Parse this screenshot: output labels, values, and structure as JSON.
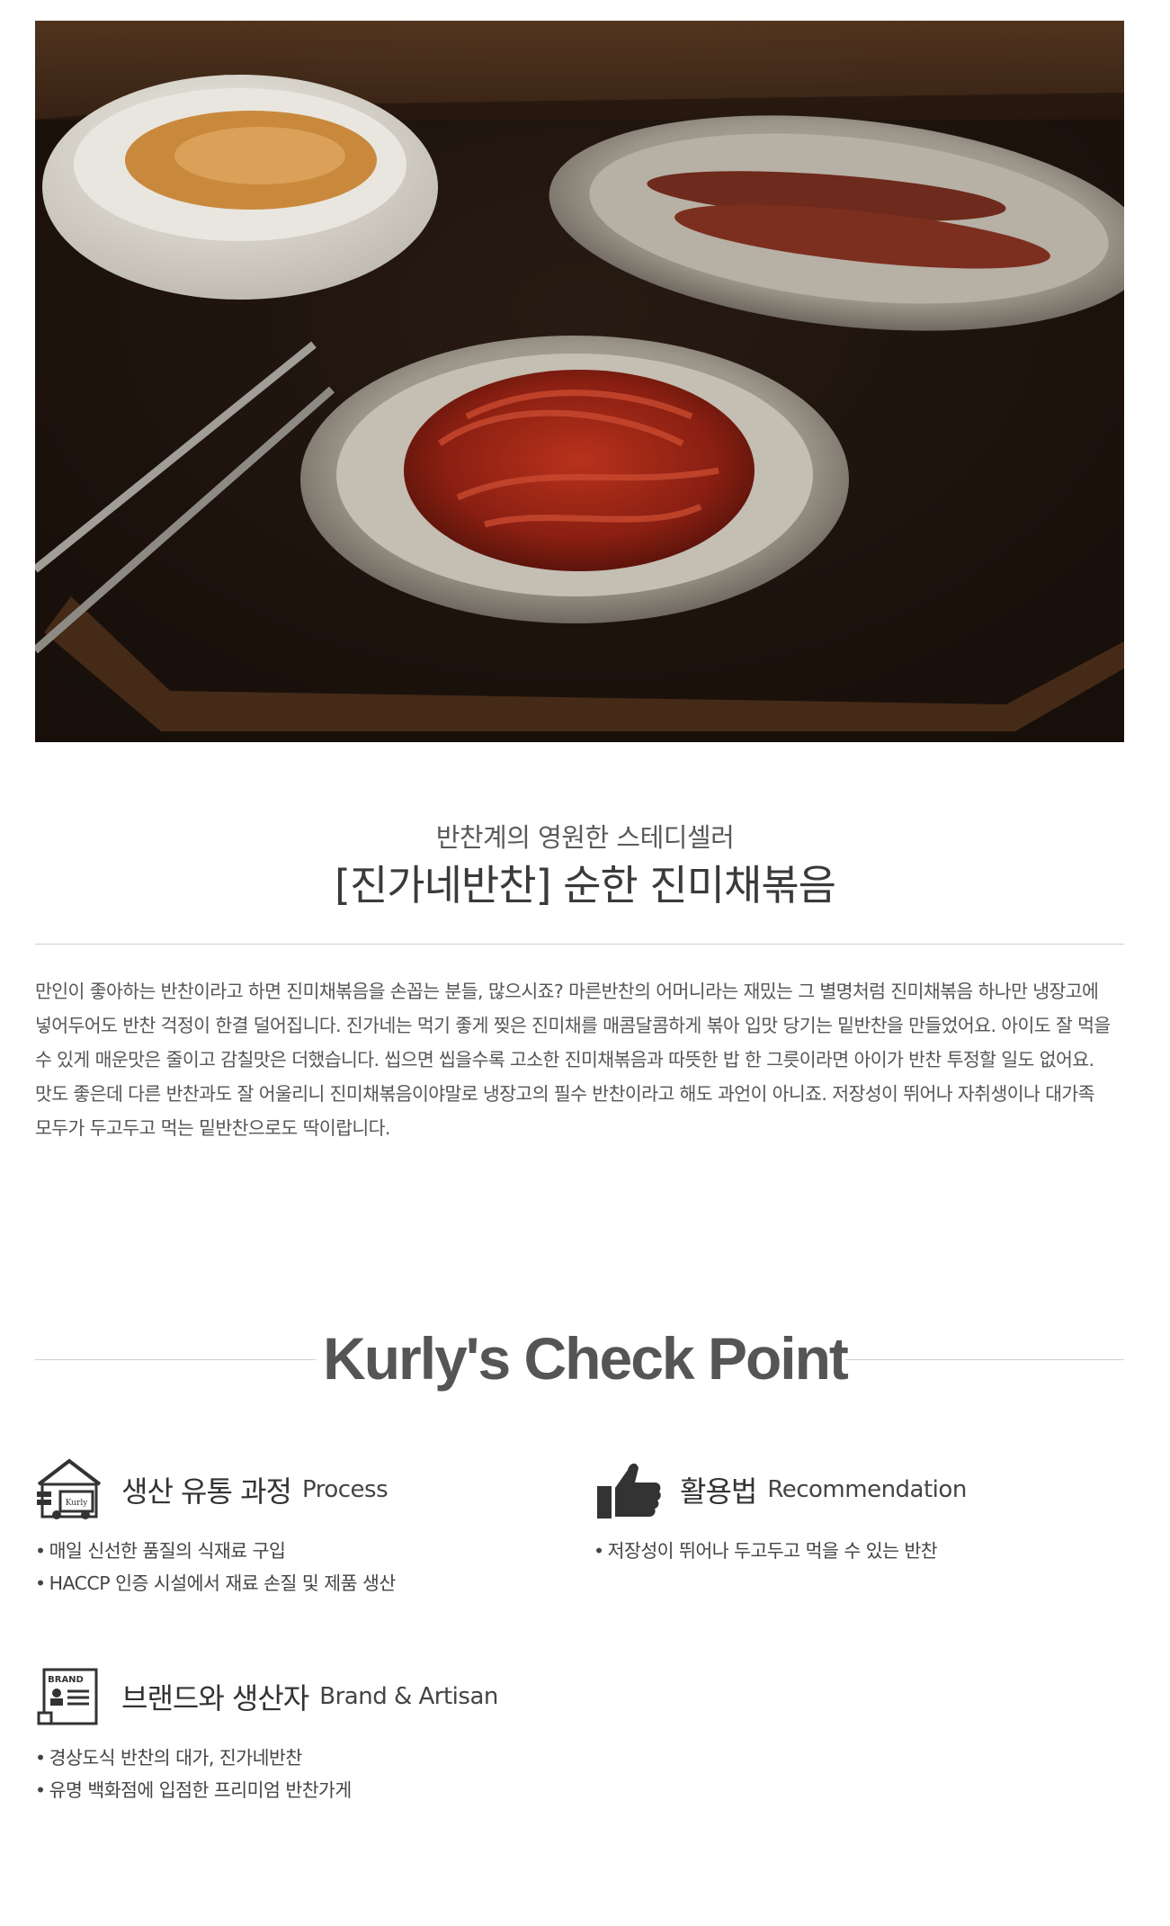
{
  "header": {
    "subtitle": "반찬계의 영원한 스테디셀러",
    "title": "[진가네반찬] 순한 진미채볶음"
  },
  "description": "만인이 좋아하는 반찬이라고 하면 진미채볶음을 손꼽는 분들, 많으시죠? 마른반찬의 어머니라는 재밌는 그 별명처럼 진미채볶음 하나만 냉장고에 넣어두어도 반찬 걱정이 한결 덜어집니다. 진가네는 먹기 좋게 찢은 진미채를 매콤달콤하게 볶아 입맛 당기는 밑반찬을 만들었어요. 아이도 잘 먹을 수 있게 매운맛은 줄이고 감칠맛은 더했습니다. 씹으면 씹을수록 고소한 진미채볶음과 따뜻한 밥 한 그릇이라면 아이가 반찬 투정할 일도 없어요. 맛도 좋은데 다른 반찬과도 잘 어울리니 진미채볶음이야말로 냉장고의 필수 반찬이라고 해도 과언이 아니죠. 저장성이 뛰어나 자취생이나 대가족 모두가 두고두고 먹는 밑반찬으로도 딱이랍니다.",
  "checkpoint": {
    "title": "Kurly's Check Point",
    "process": {
      "icon": "delivery-truck-house-icon",
      "label_ko": "생산 유통 과정",
      "label_en": "Process",
      "items": [
        "매일 신선한 품질의 식재료 구입",
        "HACCP 인증 시설에서 재료 손질 및 제품 생산"
      ]
    },
    "recommendation": {
      "icon": "thumbs-up-icon",
      "label_ko": "활용법",
      "label_en": "Recommendation",
      "items": [
        "저장성이 뛰어나 두고두고 먹을 수 있는 반찬"
      ]
    },
    "brand": {
      "icon": "brand-document-icon",
      "icon_text": "BRAND",
      "label_ko": "브랜드와 생산자",
      "label_en": "Brand & Artisan",
      "items": [
        "경상도식 반찬의 대가, 진가네반찬",
        "유명 백화점에 입점한 프리미엄 반찬가게"
      ]
    }
  }
}
